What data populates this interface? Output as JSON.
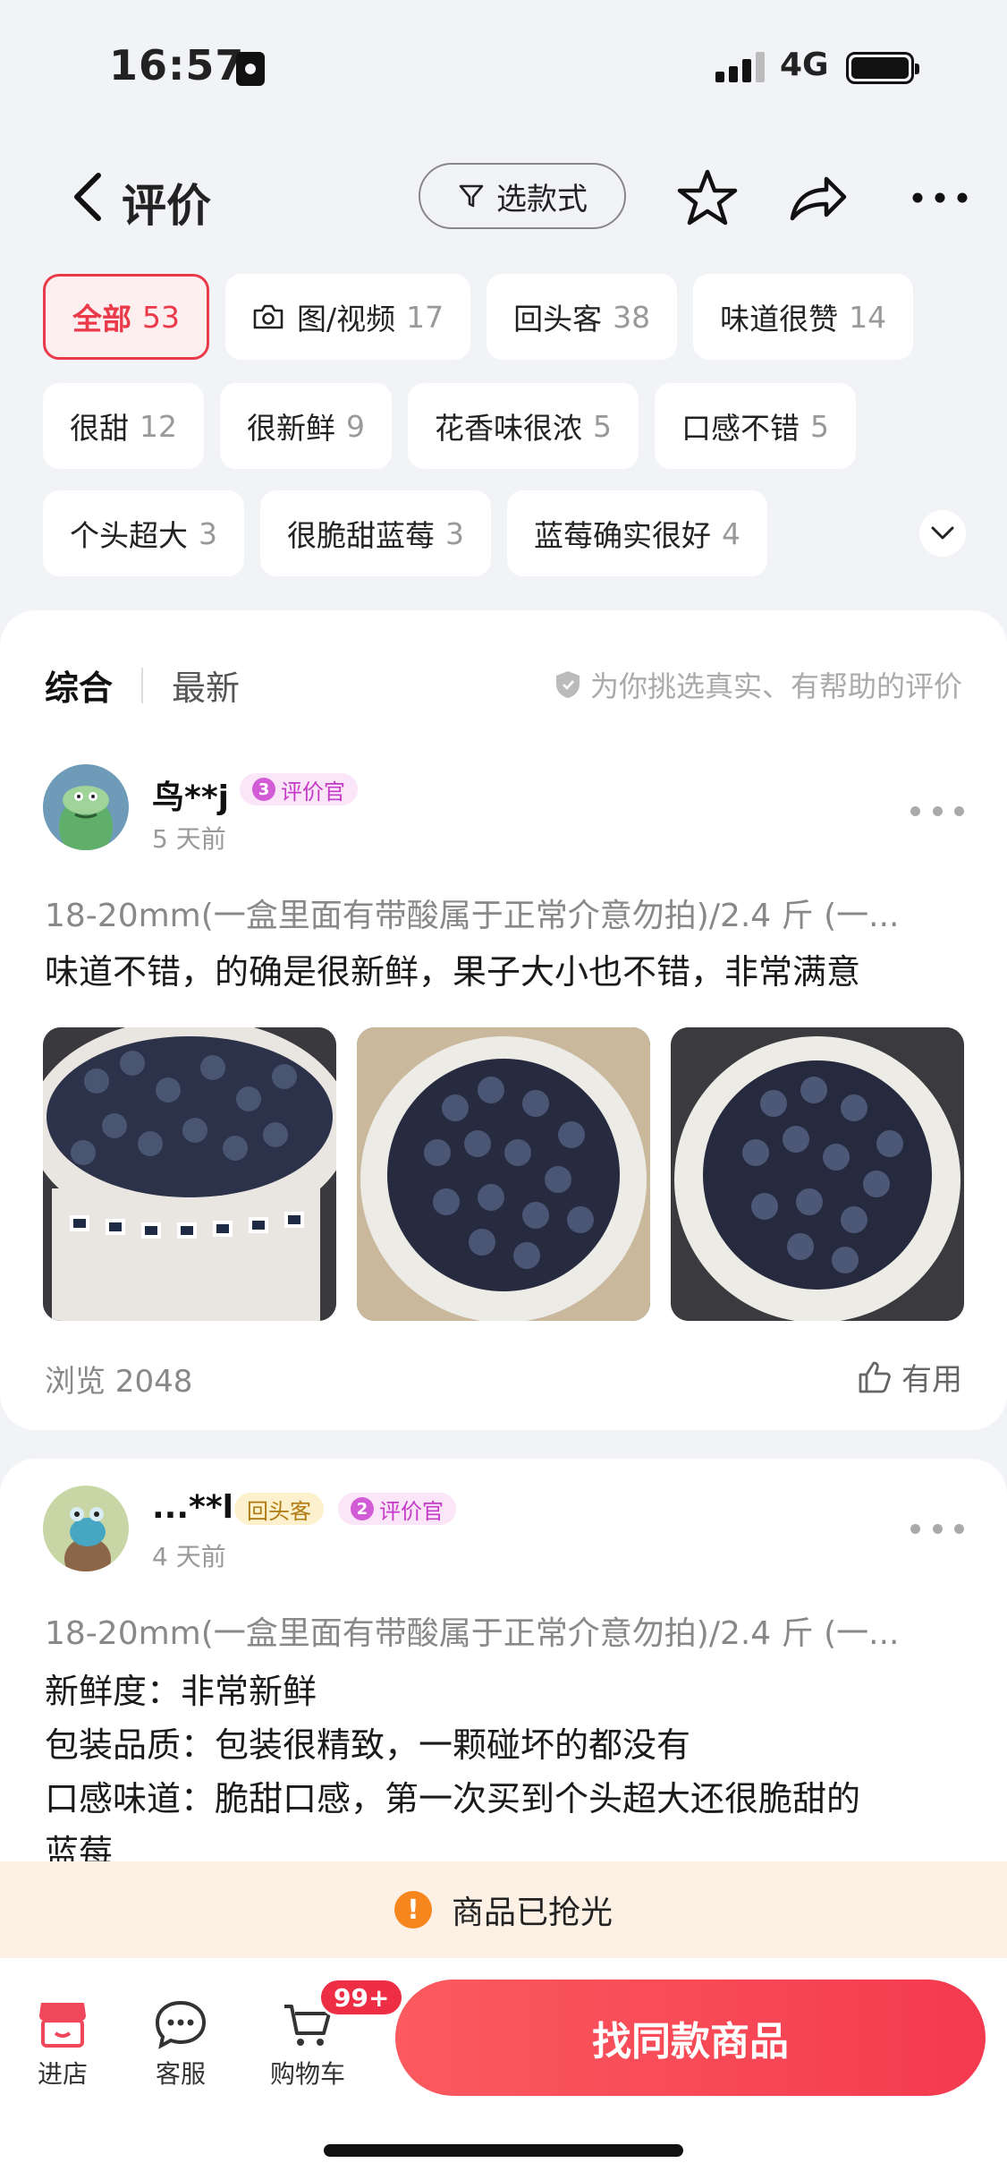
{
  "status_bar": {
    "time": "16:57",
    "network": "4G"
  },
  "header": {
    "title": "评价",
    "filter_label": "选款式"
  },
  "tags": [
    {
      "label": "全部",
      "count": "53"
    },
    {
      "label": "图/视频",
      "count": "17"
    },
    {
      "label": "回头客",
      "count": "38"
    },
    {
      "label": "味道很赞",
      "count": "14"
    },
    {
      "label": "很甜",
      "count": "12"
    },
    {
      "label": "很新鲜",
      "count": "9"
    },
    {
      "label": "花香味很浓",
      "count": "5"
    },
    {
      "label": "口感不错",
      "count": "5"
    },
    {
      "label": "个头超大",
      "count": "3"
    },
    {
      "label": "很脆甜蓝莓",
      "count": "3"
    },
    {
      "label": "蓝莓确实很好",
      "count": "4"
    }
  ],
  "sort": {
    "tabs": [
      "综合",
      "最新"
    ],
    "hint": "为你挑选真实、有帮助的评价"
  },
  "reviews": [
    {
      "user": "鸟**j",
      "judge_level": "3",
      "judge_label": "评价官",
      "time": "5 天前",
      "sku": "18-20mm(一盒里面有带酸属于正常介意勿拍)/2.4 斤 (一...",
      "text": "味道不错，的确是很新鲜，果子大小也不错，非常满意",
      "views": "浏览 2048",
      "useful": "有用"
    },
    {
      "user": "...**l",
      "repeat_label": "回头客",
      "judge_level": "2",
      "judge_label": "评价官",
      "time": "4 天前",
      "sku": "18-20mm(一盒里面有带酸属于正常介意勿拍)/2.4 斤 (一...",
      "lines": [
        "新鲜度：非常新鲜",
        "包装品质：包装很精致，一颗碰坏的都没有",
        "口感味道：脆甜口感，第一次买到个头超大还很脆甜的",
        "蓝莓"
      ]
    }
  ],
  "soldout_text": "商品已抢光",
  "bottom_bar": {
    "store": "进店",
    "service": "客服",
    "cart": "购物车",
    "cart_badge": "99+",
    "cta": "找同款商品"
  },
  "colors": {
    "accent": "#ea3a4a",
    "cta": "#f43a4f",
    "judge": "#c43ac7"
  }
}
